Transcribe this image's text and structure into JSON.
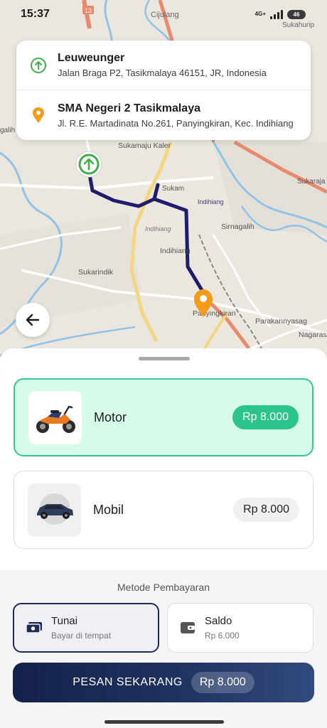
{
  "status_bar": {
    "time": "15:37",
    "network": "4G+",
    "battery": "46"
  },
  "map": {
    "labels": {
      "cijulang": "Cijulang",
      "sukahurip": "Sukahurip",
      "galih": "galih",
      "sukamaju_kaler": "Sukamaju Kaler",
      "sukajaya": "Sukaraja",
      "sukamaju": "Sukam",
      "indihiang_road": "Indihiang",
      "sirnagalih": "Sirnagalih",
      "indihiang": "Indihiang",
      "indihiang_area": "Indihiang",
      "sukarindik": "Sukarindik",
      "panyingkiran": "Panyingkiran",
      "parakannyasag": "Parakannyasag",
      "nagarasari": "Nagaras",
      "road_13": "13"
    }
  },
  "route": {
    "origin": {
      "title": "Leuweunger",
      "address": "Jalan Braga P2, Tasikmalaya 46151, JR, Indonesia"
    },
    "destination": {
      "title": "SMA Negeri 2 Tasikmalaya",
      "address": "Jl. R.E. Martadinata No.261, Panyingkiran, Kec. Indihiang"
    }
  },
  "vehicles": [
    {
      "name": "Motor",
      "price": "Rp 8.000",
      "selected": true
    },
    {
      "name": "Mobil",
      "price": "Rp 8.000",
      "selected": false
    }
  ],
  "payment": {
    "heading": "Metode Pembayaran",
    "options": [
      {
        "title": "Tunai",
        "subtitle": "Bayar di tempat",
        "selected": true
      },
      {
        "title": "Saldo",
        "subtitle": "Rp 6.000",
        "selected": false
      }
    ]
  },
  "order_button": {
    "label": "PESAN SEKARANG",
    "price": "Rp 8.000"
  },
  "colors": {
    "accent_green": "#2bc48a",
    "route_line": "#1f1d6b",
    "origin_pin": "#3fae47",
    "destination_pin": "#f59b1a",
    "primary_dark": "#14224a"
  },
  "icons": {
    "origin": "arrow-up-circle-icon",
    "destination": "location-pin-icon",
    "back": "arrow-left-icon",
    "cash": "cash-icon",
    "wallet": "wallet-icon"
  }
}
